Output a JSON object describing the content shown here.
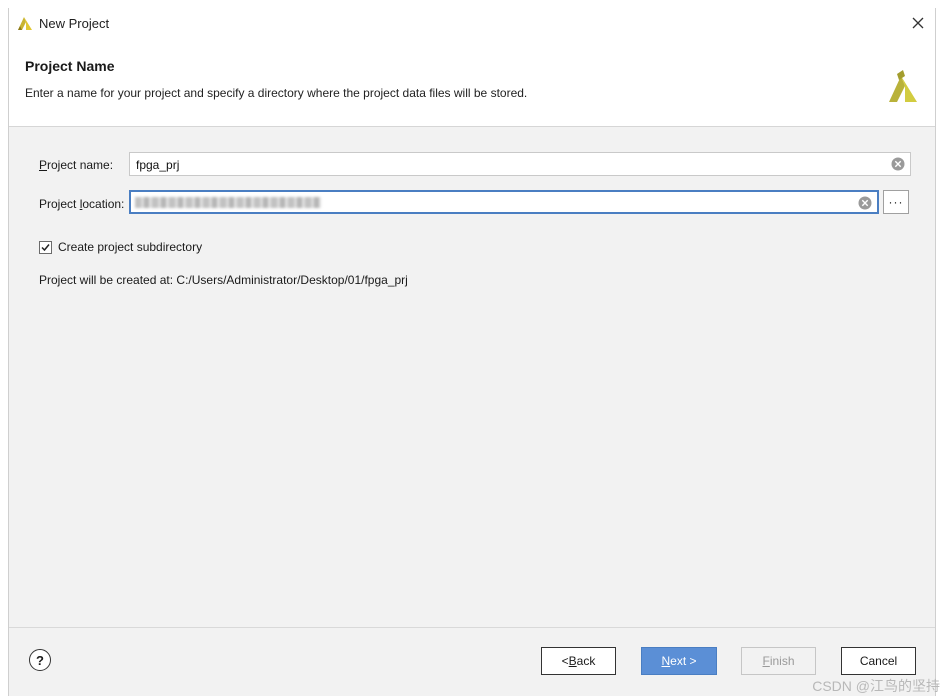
{
  "window": {
    "title": "New Project"
  },
  "header": {
    "title": "Project Name",
    "description": "Enter a name for your project and specify a directory where the project data files will be stored."
  },
  "form": {
    "project_name": {
      "label_pre": "P",
      "label_rest": "roject name:",
      "value": "fpga_prj"
    },
    "project_location": {
      "label_pre": "Project ",
      "label_ul": "l",
      "label_rest": "ocation:",
      "value": ""
    },
    "subdirectory": {
      "label": "Create project subdirectory",
      "checked": true
    },
    "created_at_note": "Project will be created at: C:/Users/Administrator/Desktop/01/fpga_prj",
    "browse_label": "···"
  },
  "footer": {
    "help_label": "?",
    "back": {
      "pre": "< ",
      "ul": "B",
      "rest": "ack"
    },
    "next": {
      "ul": "N",
      "rest": "ext >"
    },
    "finish": {
      "ul": "F",
      "rest": "inish"
    },
    "cancel": "Cancel"
  },
  "watermark": "CSDN @江鸟的坚持",
  "colors": {
    "accent": "#4a7ec2",
    "next_button": "#5b8fd6",
    "logo": "#c6c238"
  }
}
